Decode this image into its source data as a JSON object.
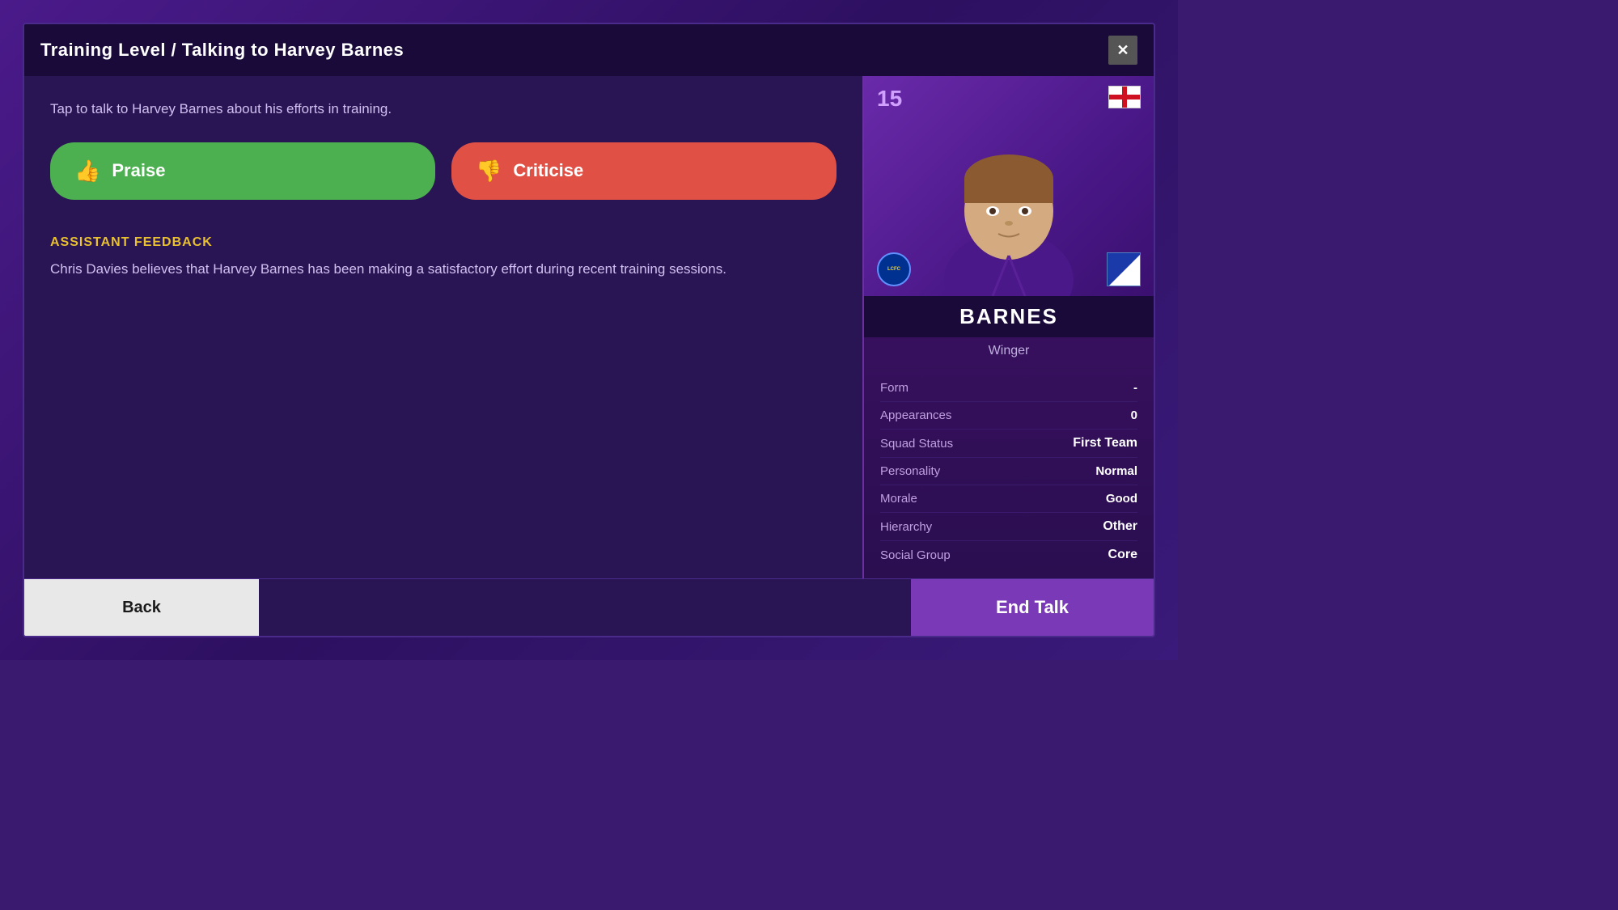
{
  "dialog": {
    "title": "Training Level / Talking to Harvey Barnes",
    "close_label": "✕",
    "intro_text": "Tap to talk to Harvey Barnes about his efforts in training.",
    "praise_label": "Praise",
    "criticise_label": "Criticise",
    "assistant_section_label": "ASSISTANT FEEDBACK",
    "assistant_text": "Chris Davies believes that Harvey Barnes has been making a satisfactory effort during recent training sessions.",
    "back_label": "Back",
    "end_talk_label": "End Talk"
  },
  "player_card": {
    "number": "15",
    "name": "BARNES",
    "position": "Winger",
    "club": "Leicester City",
    "stats": [
      {
        "label": "Form",
        "value": "-"
      },
      {
        "label": "Appearances",
        "value": "0"
      },
      {
        "label": "Squad Status",
        "value": "First Team"
      },
      {
        "label": "Personality",
        "value": "Normal"
      },
      {
        "label": "Morale",
        "value": "Good"
      },
      {
        "label": "Hierarchy",
        "value": "Other"
      },
      {
        "label": "Social Group",
        "value": "Core"
      }
    ]
  },
  "colors": {
    "praise_bg": "#4caf50",
    "criticise_bg": "#e05045",
    "assistant_label": "#e8c030",
    "end_talk_bg": "#7a3ab8"
  }
}
